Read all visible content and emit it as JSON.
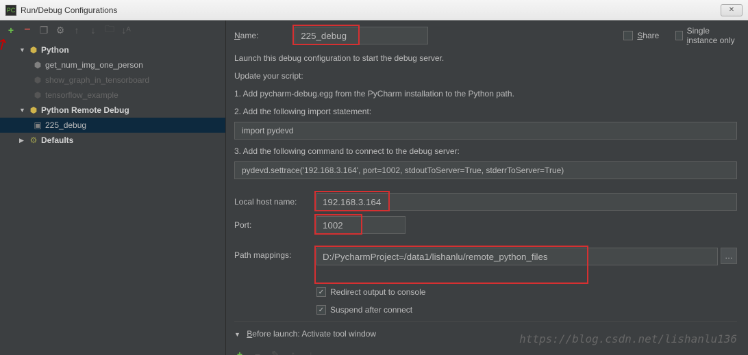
{
  "window": {
    "title": "Run/Debug Configurations",
    "icon": "PC"
  },
  "sidebar": {
    "groups": [
      {
        "label": "Python",
        "expanded": true,
        "icon": "python",
        "children": [
          {
            "label": "get_num_img_one_person",
            "dim": false
          },
          {
            "label": "show_graph_in_tensorboard",
            "dim": true
          },
          {
            "label": "tensorflow_example",
            "dim": true
          }
        ]
      },
      {
        "label": "Python Remote Debug",
        "expanded": true,
        "icon": "python",
        "children": [
          {
            "label": "225_debug",
            "selected": true
          }
        ]
      },
      {
        "label": "Defaults",
        "expanded": false,
        "icon": "gear",
        "children": []
      }
    ]
  },
  "form": {
    "name_label": "Name:",
    "name_value": "225_debug",
    "share_label": "Share",
    "single_instance_label": "Single instance only",
    "info1": "Launch this debug configuration to start the debug server.",
    "info2": "Update your script:",
    "info3": "1. Add pycharm-debug.egg from the PyCharm installation to the Python path.",
    "info4": "2. Add the following import statement:",
    "code1": "import pydevd",
    "info5": "3. Add the following command to connect to the debug server:",
    "code2": "pydevd.settrace('192.168.3.164', port=1002, stdoutToServer=True, stderrToServer=True)",
    "host_label": "Local host name:",
    "host_value": "192.168.3.164",
    "port_label": "Port:",
    "port_value": "1002",
    "path_label": "Path mappings:",
    "path_value": "D:/PycharmProject=/data1/lishanlu/remote_python_files",
    "redirect_label": "Redirect output to console",
    "suspend_label": "Suspend after connect",
    "before_launch": "Before launch: Activate tool window"
  },
  "watermark": "https://blog.csdn.net/lishanlu136"
}
